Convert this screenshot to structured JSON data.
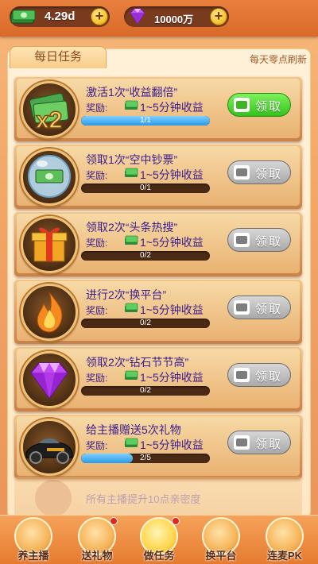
{
  "topbar": {
    "cash_value": "4.29d",
    "gem_value": "10000万",
    "plus": "+"
  },
  "panel": {
    "tab_label": "每日任务",
    "refresh_note": "每天零点刷新"
  },
  "tasks": [
    {
      "title": "激活1次“收益翻倍”",
      "reward_label": "奖励:",
      "reward": "1~5分钟收益",
      "progress_text": "1/1",
      "progress": 1.0,
      "button": "领取",
      "claimable": true,
      "icon": "double-x2-icon"
    },
    {
      "title": "领取1次“空中钞票”",
      "reward_label": "奖励:",
      "reward": "1~5分钟收益",
      "progress_text": "0/1",
      "progress": 0,
      "button": "领取",
      "claimable": false,
      "icon": "money-bubble-icon"
    },
    {
      "title": "领取2次“头条热搜”",
      "reward_label": "奖励:",
      "reward": "1~5分钟收益",
      "progress_text": "0/2",
      "progress": 0,
      "button": "领取",
      "claimable": false,
      "icon": "gift-box-icon"
    },
    {
      "title": "进行2次“换平台”",
      "reward_label": "奖励:",
      "reward": "1~5分钟收益",
      "progress_text": "0/2",
      "progress": 0,
      "button": "领取",
      "claimable": false,
      "icon": "flame-icon"
    },
    {
      "title": "领取2次“钻石节节高”",
      "reward_label": "奖励:",
      "reward": "1~5分钟收益",
      "progress_text": "0/2",
      "progress": 0,
      "button": "领取",
      "claimable": false,
      "icon": "diamond-icon"
    },
    {
      "title": "给主播赠送5次礼物",
      "reward_label": "奖励:",
      "reward": "1~5分钟收益",
      "progress_text": "2/5",
      "progress": 0.4,
      "button": "领取",
      "claimable": false,
      "icon": "sports-car-icon"
    }
  ],
  "faded_task": {
    "title": "所有主播提升10点亲密度"
  },
  "nav": [
    {
      "label": "养主播",
      "icon": "anchor-avatar-icon",
      "dot": false,
      "active": false
    },
    {
      "label": "送礼物",
      "icon": "gift-money-icon",
      "dot": true,
      "active": false
    },
    {
      "label": "做任务",
      "icon": "task-board-icon",
      "dot": true,
      "active": true
    },
    {
      "label": "换平台",
      "icon": "platform-coin-icon",
      "dot": false,
      "active": false
    },
    {
      "label": "连麦PK",
      "icon": "headset-icon",
      "dot": false,
      "active": false
    }
  ]
}
